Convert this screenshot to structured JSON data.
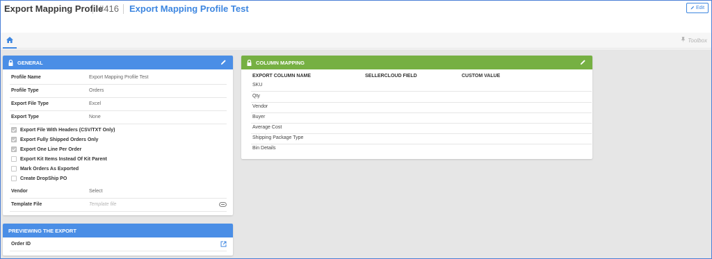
{
  "header": {
    "title": "Export Mapping Profile",
    "number": "#416",
    "profile_name": "Export Mapping Profile Test",
    "edit_label": "Edit"
  },
  "tabs": {
    "home_icon": "home-icon",
    "toolbox_label": "Toolbox",
    "toolbox_icon": "pin-icon"
  },
  "general": {
    "title": "GENERAL",
    "fields": [
      {
        "label": "Profile Name",
        "value": "Export Mapping Profile Test"
      },
      {
        "label": "Profile Type",
        "value": "Orders"
      },
      {
        "label": "Export File Type",
        "value": "Excel"
      },
      {
        "label": "Export Type",
        "value": "None"
      }
    ],
    "checkboxes": [
      {
        "label": "Export File With Headers (CSV/TXT Only)",
        "checked": true
      },
      {
        "label": "Export Fully Shipped Orders Only",
        "checked": true
      },
      {
        "label": "Export One Line Per Order",
        "checked": true
      },
      {
        "label": "Export Kit Items Instead Of Kit Parent",
        "checked": false
      },
      {
        "label": "Mark Orders As Exported",
        "checked": false
      },
      {
        "label": "Create DropShip PO",
        "checked": false
      }
    ],
    "vendor_label": "Vendor",
    "vendor_value": "Select",
    "template_label": "Template File",
    "template_placeholder": "Template file"
  },
  "preview": {
    "title": "PREVIEWING THE EXPORT",
    "order_id_label": "Order ID"
  },
  "column_mapping": {
    "title": "COLUMN MAPPING",
    "headers": [
      "EXPORT COLUMN NAME",
      "SELLERCLOUD FIELD",
      "CUSTOM VALUE"
    ],
    "rows": [
      "SKU",
      "Qty",
      "Vendor",
      "Buyer",
      "Average Cost",
      "Shipping Package Type",
      "Bin Details"
    ]
  },
  "colors": {
    "accent_blue": "#4a8ee6",
    "accent_green": "#76b043",
    "link_blue": "#3d86e0"
  }
}
